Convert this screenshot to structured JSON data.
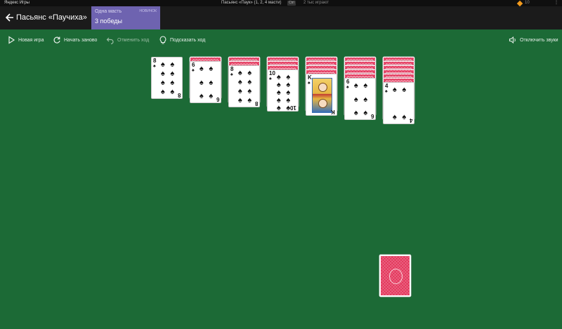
{
  "system_bar": {
    "brand": "Яндекс Игры",
    "window_title": "Пасьянс «Паук» (1, 2, 4 масти)",
    "kbd": "Ctrl",
    "players": "2 тыс играют",
    "coins": "10",
    "more": "⋮"
  },
  "header": {
    "title": "Пасьянс «Паучиха»",
    "mode": {
      "name": "Одна масть",
      "tag": "НОВИЧОК",
      "wins": "3 победы"
    }
  },
  "toolbar": {
    "new_game": "Новая игра",
    "restart": "Начать заново",
    "undo": "Отменить ход",
    "hint": "Подсказать ход",
    "sound": "Отключить звуки"
  },
  "colors": {
    "table": "#1c6a36",
    "card_back": "#e3345a",
    "mode_panel": "#6e63b0",
    "header": "#1b1b1b"
  },
  "tableau": [
    {
      "face_down": 0,
      "face_up": [
        {
          "rank": "8",
          "suit": "♠"
        }
      ]
    },
    {
      "face_down": 1,
      "face_up": [
        {
          "rank": "6",
          "suit": "♠"
        }
      ]
    },
    {
      "face_down": 2,
      "face_up": [
        {
          "rank": "8",
          "suit": "♠"
        }
      ]
    },
    {
      "face_down": 3,
      "face_up": [
        {
          "rank": "10",
          "suit": "♠"
        }
      ]
    },
    {
      "face_down": 4,
      "face_up": [
        {
          "rank": "K",
          "suit": "♠"
        }
      ]
    },
    {
      "face_down": 5,
      "face_up": [
        {
          "rank": "6",
          "suit": "♠"
        }
      ]
    },
    {
      "face_down": 6,
      "face_up": [
        {
          "rank": "4",
          "suit": "♠"
        }
      ]
    }
  ],
  "stock": {
    "piles": 1
  }
}
